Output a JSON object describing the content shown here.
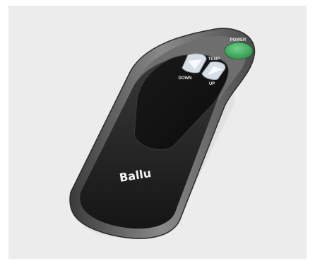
{
  "product": {
    "brand": "Ballu",
    "labels": {
      "power": "POWER",
      "temp": "TEMP",
      "down": "DOWN",
      "up": "UP"
    }
  },
  "colors": {
    "background": "#ececec",
    "body_outer": "#5a5a5a",
    "body_face": "#1f1f1f",
    "button_power": "#3aa65a",
    "button_arrow": "#e8eef3"
  }
}
